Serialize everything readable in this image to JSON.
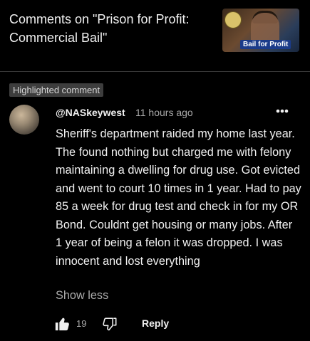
{
  "header": {
    "title": "Comments on \"Prison for Profit: Commercial Bail\"",
    "thumbnail_caption": "Bail for Profit"
  },
  "highlight_label": "Highlighted comment",
  "comment": {
    "author": "@NASkeywest",
    "time": "11 hours ago",
    "more_icon": "more-vertical-icon",
    "text": "Sheriff's department raided my home last year. The found nothing but charged me with felony maintaining a dwelling for drug use. Got evicted and went to court 10 times in 1 year. Had to pay 85 a week for drug test and check in for my OR Bond. Couldnt get housing or many jobs. After 1 year of being a felon it was dropped. I was innocent and lost everything",
    "show_less": "Show less",
    "like_count": "19",
    "reply_label": "Reply"
  },
  "colors": {
    "background": "#000000",
    "text_primary": "#f1f1f1",
    "text_secondary": "#aaaaaa",
    "chip_bg": "#3d3d3d"
  }
}
